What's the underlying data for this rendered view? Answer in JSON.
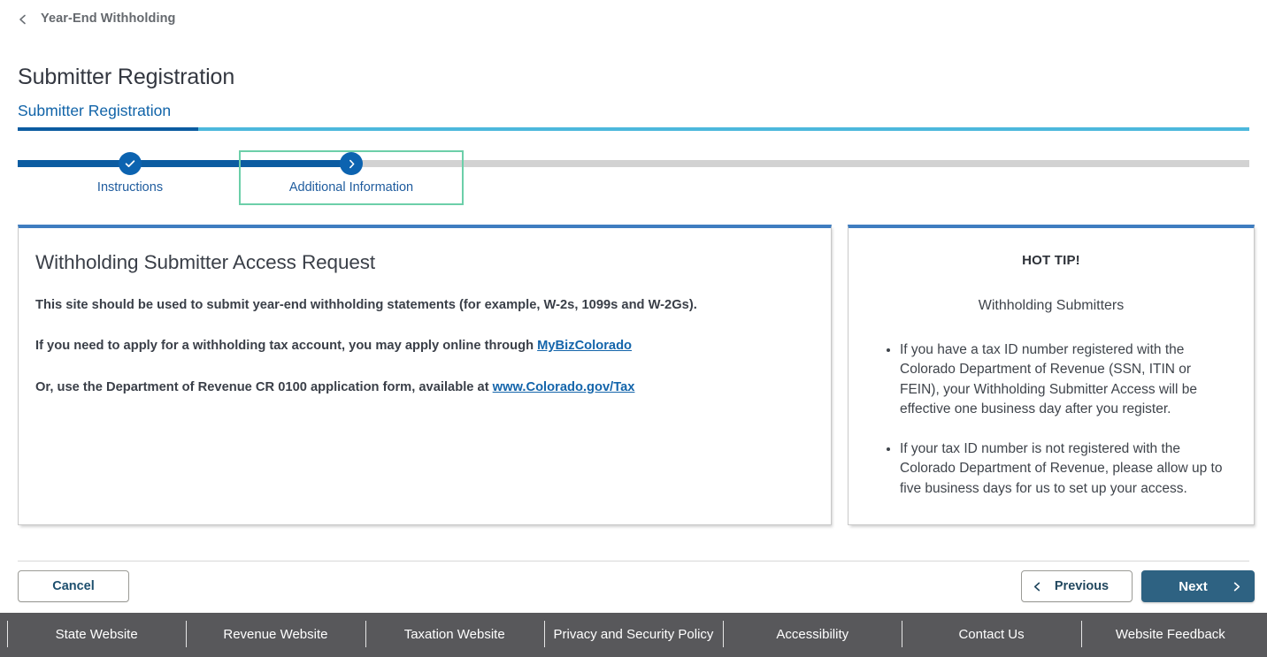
{
  "breadcrumb": {
    "icon": "chevron-left-icon",
    "label": "Year-End Withholding"
  },
  "page": {
    "title": "Submitter Registration"
  },
  "tabs": [
    {
      "label": "Submitter Registration",
      "active": true
    }
  ],
  "stepper": {
    "steps": [
      {
        "label": "Instructions",
        "state": "complete",
        "icon": "check-icon"
      },
      {
        "label": "Additional Information",
        "state": "current",
        "icon": "chevron-right-icon"
      }
    ],
    "focused_step": "Additional Information"
  },
  "main_panel": {
    "heading": "Withholding Submitter Access Request",
    "paragraphs": [
      {
        "before": "This site should be used to submit year-end withholding statements (for example, W-2s, 1099s and W-2Gs).",
        "link": "",
        "after": ""
      },
      {
        "before": "If you need to apply for a withholding tax account, you may apply online through ",
        "link": "MyBizColorado",
        "after": ""
      },
      {
        "before": "Or, use the Department of Revenue CR 0100 application form, available at ",
        "link": "www.Colorado.gov/Tax",
        "after": ""
      }
    ]
  },
  "tip_panel": {
    "title": "HOT TIP!",
    "subtitle": "Withholding Submitters",
    "bullets": [
      "If you have a tax ID number registered with the Colorado Department of Revenue (SSN, ITIN or FEIN), your Withholding Submitter Access will be effective one business day after you register.",
      "If your tax ID number is not registered with the Colorado Department of Revenue, please allow up to five business days for us to set up your access."
    ]
  },
  "actions": {
    "cancel": "Cancel",
    "previous": "Previous",
    "next": "Next"
  },
  "footer": {
    "links": [
      "State Website",
      "Revenue Website",
      "Taxation Website",
      "Privacy and Security Policy",
      "Accessibility",
      "Contact Us",
      "Website Feedback"
    ]
  },
  "colors": {
    "brand_blue": "#0c5ca1",
    "tab_rail_cyan": "#4cb8dc",
    "panel_accent": "#3f7dc0",
    "focus_green": "#6ccfa9",
    "next_button": "#2e6282",
    "footer_bg": "#58585b",
    "link_blue": "#1465ab"
  }
}
